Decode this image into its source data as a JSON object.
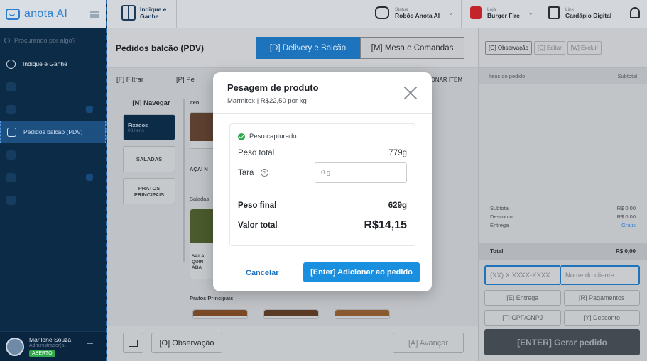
{
  "brand": {
    "name": "anota AI"
  },
  "sidebar": {
    "search_placeholder": "Procurando por algo?",
    "refer_label": "Indique e Ganhe",
    "active_label": "Pedidos balcão (PDV)",
    "user": {
      "name": "Marilene Souza",
      "role": "Administrador(a)",
      "status": "ABERTO"
    }
  },
  "topbar": {
    "refer_label": "Indique e Ganhe",
    "status": {
      "label": "Status",
      "value": "Robôs Anota AI"
    },
    "store": {
      "label": "Loja",
      "value": "Burger Fire"
    },
    "menu": {
      "label": "Link",
      "value": "Cardápio Digital"
    }
  },
  "main": {
    "title": "Pedidos balcão (PDV)",
    "tabs": [
      "[D] Delivery e Balcão",
      "[M] Mesa e Comandas"
    ],
    "filter_label": "[F] Filtrar",
    "filter_second": "[P] Pe",
    "add_item_label": "ONAR ITEM",
    "nav_label": "[N] Navegar",
    "categories": [
      {
        "name": "Fixados",
        "count": "03 itens"
      },
      {
        "name": "SALADAS"
      },
      {
        "name": "PRATOS PRINCIPAIS"
      }
    ],
    "items_label": "Iten",
    "section_salads": "Saladas",
    "section_main": "Pratos Principais",
    "product_acai": "AÇAÍ N",
    "product_salad": "SALA QUIN ABA",
    "footer": {
      "observation": "[O] Observação",
      "advance": "[A] Avançar"
    }
  },
  "right_panel": {
    "actions": [
      "[O] Observação",
      "[Q] Editar",
      "[W] Excluir"
    ],
    "items_header": "Itens do pedido",
    "subtotal_header": "Subtotal",
    "lines": [
      {
        "label": "Subtotal",
        "value": "R$ 0,00"
      },
      {
        "label": "Desconto",
        "value": "R$ 0,00"
      },
      {
        "label": "Entrega",
        "value": "Grátis"
      }
    ],
    "total_label": "Total",
    "total_value": "R$ 0,00",
    "phone_placeholder": "(XX) X XXXX-XXXX",
    "name_placeholder": "Nome do cliente",
    "buttons": [
      "[E] Entrega",
      "[R] Pagamentos",
      "[T] CPF/CNPJ",
      "[Y] Desconto"
    ],
    "generate_label": "[ENTER] Gerar pedido"
  },
  "modal": {
    "title": "Pesagem de produto",
    "subtitle": "Marmitex | R$22,50 por kg",
    "captured_label": "Peso capturado",
    "total_weight_label": "Peso total",
    "total_weight_value": "779g",
    "tara_label": "Tara",
    "tara_placeholder": "0 g",
    "final_weight_label": "Peso final",
    "final_weight_value": "629g",
    "total_value_label": "Valor total",
    "total_value_value": "R$14,15",
    "cancel_label": "Cancelar",
    "add_label": "[Enter] Adicionar ao pedido"
  }
}
